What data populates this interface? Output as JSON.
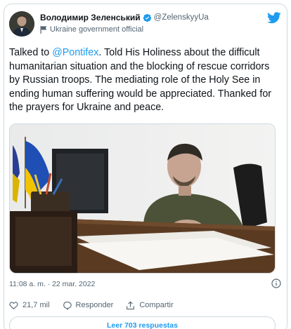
{
  "author": {
    "display_name": "Володимир Зеленський",
    "handle": "@ZelenskyyUa",
    "affiliation": "Ukraine government official",
    "verified": true,
    "avatar_icon": "profile-photo"
  },
  "tweet": {
    "text_before_mention": "Talked to ",
    "mention": "@Pontifex",
    "text_after_mention": ". Told His Holiness about the difficult humanitarian situation and the blocking of rescue corridors by Russian troops. The mediating role of the Holy See in ending human suffering would be appreciated. Thanked for the prayers for Ukraine and peace.",
    "image_alt": "photo-of-man-at-desk-with-flags",
    "timestamp": "11:08 a. m. · 22 mar. 2022"
  },
  "actions": {
    "likes": "21,7 mil",
    "reply_label": "Responder",
    "share_label": "Compartir",
    "read_replies": "Leer 703 respuestas"
  },
  "colors": {
    "accent": "#1d9bf0",
    "text": "#0f1419",
    "secondary": "#536471",
    "border": "#cfd9de"
  },
  "icons": [
    "verified-badge-icon",
    "flag-icon",
    "twitter-logo-icon",
    "info-icon",
    "heart-icon",
    "reply-icon",
    "share-icon"
  ]
}
